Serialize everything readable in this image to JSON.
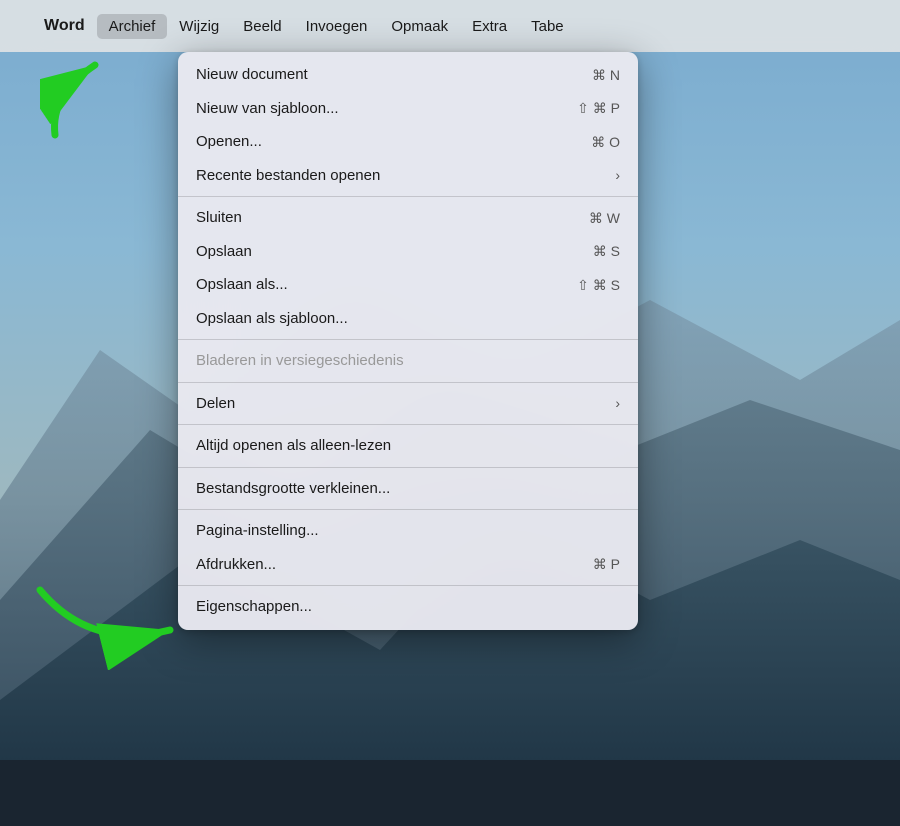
{
  "desktop": {
    "bg_desc": "macOS Big Sur desktop"
  },
  "menubar": {
    "apple_label": "",
    "word_label": "Word",
    "archief_label": "Archief",
    "wijzig_label": "Wijzig",
    "beeld_label": "Beeld",
    "invoegen_label": "Invoegen",
    "opmaak_label": "Opmaak",
    "extra_label": "Extra",
    "tabe_label": "Tabe"
  },
  "dropdown": {
    "items": [
      {
        "label": "Nieuw document",
        "shortcut": "⌘ N",
        "type": "normal",
        "has_arrow": false
      },
      {
        "label": "Nieuw van sjabloon...",
        "shortcut": "⇧ ⌘ P",
        "type": "normal",
        "has_arrow": false
      },
      {
        "label": "Openen...",
        "shortcut": "⌘ O",
        "type": "normal",
        "has_arrow": false
      },
      {
        "label": "Recente bestanden openen",
        "shortcut": "",
        "type": "normal",
        "has_arrow": true
      },
      {
        "label": "---separator---",
        "type": "separator"
      },
      {
        "label": "Sluiten",
        "shortcut": "⌘ W",
        "type": "normal",
        "has_arrow": false
      },
      {
        "label": "Opslaan",
        "shortcut": "⌘ S",
        "type": "normal",
        "has_arrow": false
      },
      {
        "label": "Opslaan als...",
        "shortcut": "⇧ ⌘ S",
        "type": "normal",
        "has_arrow": false
      },
      {
        "label": "Opslaan als sjabloon...",
        "shortcut": "",
        "type": "normal",
        "has_arrow": false
      },
      {
        "label": "---separator---",
        "type": "separator"
      },
      {
        "label": "Bladeren in versiegeschiedenis",
        "shortcut": "",
        "type": "disabled",
        "has_arrow": false
      },
      {
        "label": "---separator---",
        "type": "separator"
      },
      {
        "label": "Delen",
        "shortcut": "",
        "type": "normal",
        "has_arrow": true
      },
      {
        "label": "---separator---",
        "type": "separator"
      },
      {
        "label": "Altijd openen als alleen-lezen",
        "shortcut": "",
        "type": "normal",
        "has_arrow": false
      },
      {
        "label": "---separator---",
        "type": "separator"
      },
      {
        "label": "Bestandsgrootte verkleinen...",
        "shortcut": "",
        "type": "normal",
        "has_arrow": false
      },
      {
        "label": "---separator---",
        "type": "separator"
      },
      {
        "label": "Pagina-instelling...",
        "shortcut": "",
        "type": "normal",
        "has_arrow": false
      },
      {
        "label": "Afdrukken...",
        "shortcut": "⌘ P",
        "type": "normal",
        "has_arrow": false
      },
      {
        "label": "---separator---",
        "type": "separator"
      },
      {
        "label": "Eigenschappen...",
        "shortcut": "",
        "type": "normal",
        "has_arrow": false
      }
    ]
  }
}
